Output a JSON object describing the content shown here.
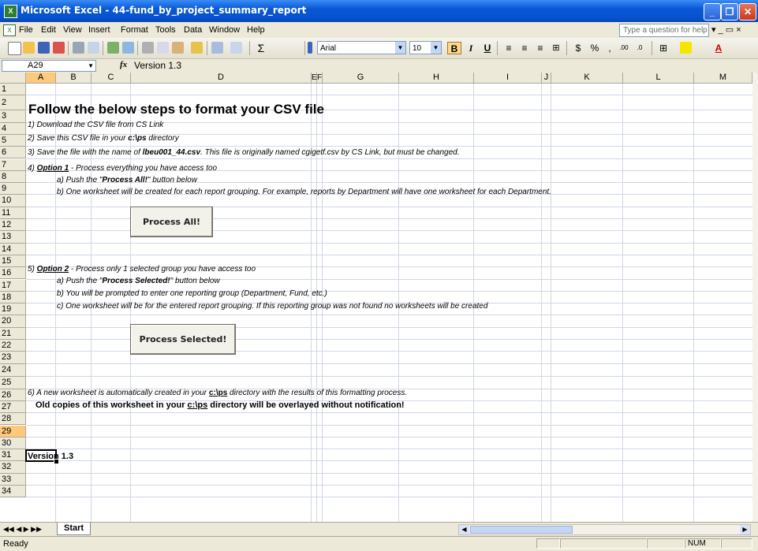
{
  "window": {
    "title": "Microsoft Excel - 44-fund_by_project_summary_report",
    "app_icon": "excel-icon",
    "minimize": "_",
    "maximize": "❐",
    "close": "✕"
  },
  "menubar": {
    "items": [
      "File",
      "Edit",
      "View",
      "Insert",
      "Format",
      "Tools",
      "Data",
      "Window",
      "Help"
    ],
    "question_placeholder": "Type a question for help",
    "mdi_controls": "▾  _  ▭  ×"
  },
  "toolbar": {
    "font_name": "Arial",
    "font_size": "10",
    "bold": "B",
    "italic": "I",
    "underline": "U",
    "currency": "$",
    "percent": "%",
    "comma": ",",
    "sum": "Σ",
    "font_color": "A"
  },
  "formula_bar": {
    "name_box": "A29",
    "fx": "fx",
    "formula": "Version 1.3"
  },
  "columns": [
    "A",
    "B",
    "C",
    "D",
    "E",
    "F",
    "G",
    "H",
    "I",
    "J",
    "K",
    "L",
    "M"
  ],
  "rows": [
    "1",
    "2",
    "3",
    "4",
    "5",
    "6",
    "7",
    "8",
    "9",
    "10",
    "11",
    "12",
    "13",
    "14",
    "15",
    "16",
    "17",
    "18",
    "19",
    "20",
    "21",
    "22",
    "23",
    "24",
    "25",
    "26",
    "27",
    "28",
    "29",
    "30",
    "31",
    "32",
    "33",
    "34"
  ],
  "cells": {
    "heading": "Follow the below steps to format your CSV file",
    "r3": "1) Download the CSV file from CS Link",
    "r4_a": "2) Save this CSV file in your ",
    "r4_b": "c:\\ps",
    "r4_c": " directory",
    "r5_a": "3) Save the file with the name of ",
    "r5_b": "lbeu001_44.csv",
    "r5_c": ".  This file is originally named cgigetf.csv by CS Link, but must be changed.",
    "r6_a": "4) ",
    "r6_b": "Option 1",
    "r6_c": " - Process everything you have access too",
    "r7_a": "a) Push the \"",
    "r7_b": "Process All!",
    "r7_c": "\" button below",
    "r8": "b) One worksheet will be created for each report grouping.  For example, reports by Department will have one worksheet for each Department.",
    "r14_a": "5) ",
    "r14_b": "Option 2",
    "r14_c": " - Process only 1 selected group you have access too",
    "r15_a": "a) Push the \"",
    "r15_b": "Process Selected!",
    "r15_c": "\" button below",
    "r16": "b) You will be prompted to enter one reporting group (Department, Fund, etc.)",
    "r17": "c) One worksheet will be for the entered report grouping.  If this reporting group was not found no worksheets will be created",
    "r24_a": "6) A new worksheet is automatically created in your ",
    "r24_b": "c:\\ps",
    "r24_c": " directory with the results of this formatting process.",
    "r25_a": "Old copies of this worksheet in your ",
    "r25_b": "c:\\ps",
    "r25_c": " directory will be overlayed without notification!",
    "r29": "Version 1.3"
  },
  "buttons": {
    "process_all": "Process  All!",
    "process_selected": "Process Selected!"
  },
  "sheet_tabs": {
    "nav": "◀◀ ◀ ▶ ▶▶",
    "active": "Start"
  },
  "status": {
    "text": "Ready",
    "num": "NUM"
  }
}
